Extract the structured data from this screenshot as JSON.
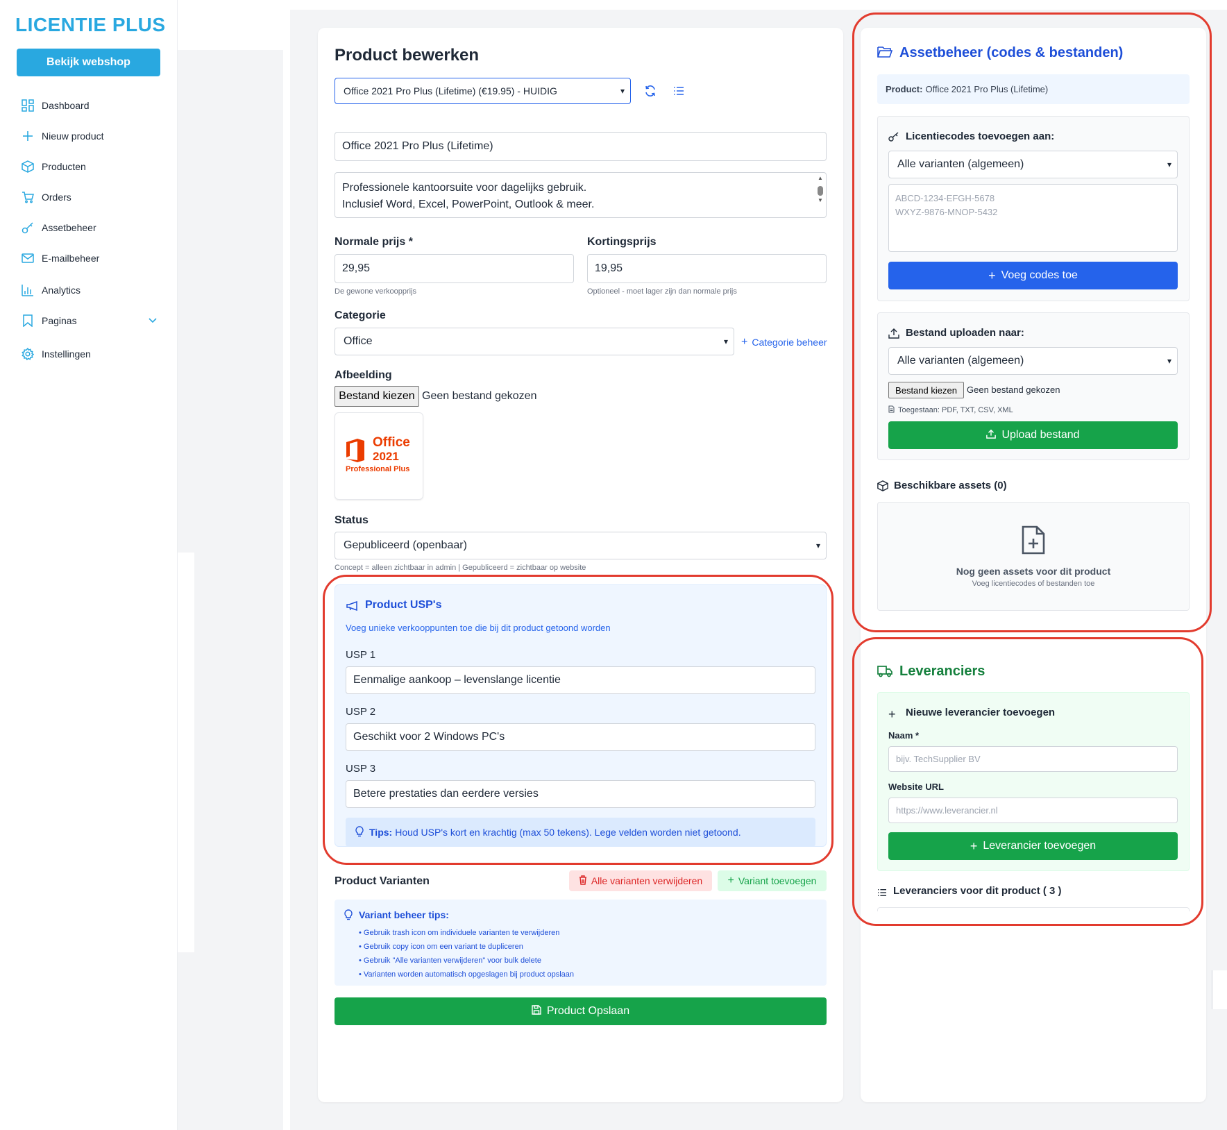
{
  "sidebar": {
    "logo": "LICENTIE PLUS",
    "webshop_button": "Bekijk webshop",
    "items": [
      {
        "label": "Dashboard",
        "icon": "dashboard-icon"
      },
      {
        "label": "Nieuw product",
        "icon": "plus-icon"
      },
      {
        "label": "Producten",
        "icon": "box-icon"
      },
      {
        "label": "Orders",
        "icon": "cart-icon"
      },
      {
        "label": "Assetbeheer",
        "icon": "key-icon"
      },
      {
        "label": "E-mailbeheer",
        "icon": "mail-icon"
      },
      {
        "label": "Analytics",
        "icon": "chart-icon"
      },
      {
        "label": "Paginas",
        "icon": "bookmark-icon"
      },
      {
        "label": "Instellingen",
        "icon": "gear-icon"
      }
    ]
  },
  "product_form": {
    "title": "Product bewerken",
    "product_select": "Office 2021 Pro Plus (Lifetime) (€19.95) - HUIDIG",
    "name_value": "Office 2021 Pro Plus (Lifetime)",
    "description_line1": "Professionele kantoorsuite voor dagelijks gebruik.",
    "description_line2": "Inclusief Word, Excel, PowerPoint, Outlook & meer.",
    "normal_price_label": "Normale prijs *",
    "normal_price_value": "29,95",
    "normal_price_hint": "De gewone verkoopprijs",
    "discount_price_label": "Kortingsprijs",
    "discount_price_value": "19,95",
    "discount_price_hint": "Optioneel - moet lager zijn dan normale prijs",
    "category_label": "Categorie",
    "category_value": "Office",
    "category_manage_link": "Categorie beheer",
    "image_label": "Afbeelding",
    "file_button": "Bestand kiezen",
    "file_none": "Geen bestand gekozen",
    "image_brand": "Office",
    "image_year": "2021",
    "image_edition": "Professional Plus",
    "status_label": "Status",
    "status_value": "Gepubliceerd (openbaar)",
    "status_hint": "Concept = alleen zichtbaar in admin | Gepubliceerd = zichtbaar op website"
  },
  "usp": {
    "title": "Product USP's",
    "subtitle": "Voeg unieke verkooppunten toe die bij dit product getoond worden",
    "items": [
      {
        "label": "USP 1",
        "value": "Eenmalige aankoop – levenslange licentie"
      },
      {
        "label": "USP 2",
        "value": "Geschikt voor 2 Windows PC's"
      },
      {
        "label": "USP 3",
        "value": "Betere prestaties dan eerdere versies"
      }
    ],
    "tips_bold": "Tips:",
    "tips_text": "Houd USP's kort en krachtig (max 50 tekens). Lege velden worden niet getoond."
  },
  "variants": {
    "title": "Product Varianten",
    "delete_all": "Alle varianten verwijderen",
    "add": "Variant toevoegen",
    "tips_title": "Variant beheer tips:",
    "tips": [
      "• Gebruik trash icon om individuele varianten te verwijderen",
      "• Gebruik copy icon om een variant te dupliceren",
      "• Gebruik \"Alle varianten verwijderen\" voor bulk delete",
      "• Varianten worden automatisch opgeslagen bij product opslaan"
    ],
    "save_button": "Product Opslaan"
  },
  "assets": {
    "title": "Assetbeheer (codes & bestanden)",
    "product_label": "Product:",
    "product_value": "Office 2021 Pro Plus (Lifetime)",
    "codes_title": "Licentiecodes toevoegen aan:",
    "codes_select": "Alle varianten (algemeen)",
    "codes_placeholder_1": "ABCD-1234-EFGH-5678",
    "codes_placeholder_2": "WXYZ-9876-MNOP-5432",
    "codes_button": "Voeg codes toe",
    "upload_title": "Bestand uploaden naar:",
    "upload_select": "Alle varianten (algemeen)",
    "file_button": "Bestand kiezen",
    "file_none": "Geen bestand gekozen",
    "allowed": "Toegestaan: PDF, TXT, CSV, XML",
    "upload_button": "Upload bestand",
    "available_title": "Beschikbare assets (0)",
    "empty_title": "Nog geen assets voor dit product",
    "empty_sub": "Voeg licentiecodes of bestanden toe"
  },
  "suppliers": {
    "title": "Leveranciers",
    "new_title": "Nieuwe leverancier toevoegen",
    "name_label": "Naam *",
    "name_placeholder": "bijv. TechSupplier BV",
    "url_label": "Website URL",
    "url_placeholder": "https://www.leverancier.nl",
    "add_button": "Leverancier toevoegen",
    "list_title": "Leveranciers voor dit product ( 3 )"
  },
  "colors": {
    "brand": "#29a8e0",
    "primary": "#2563eb",
    "success": "#16a34a",
    "danger": "#dc2626",
    "highlight": "#e23b2e"
  }
}
